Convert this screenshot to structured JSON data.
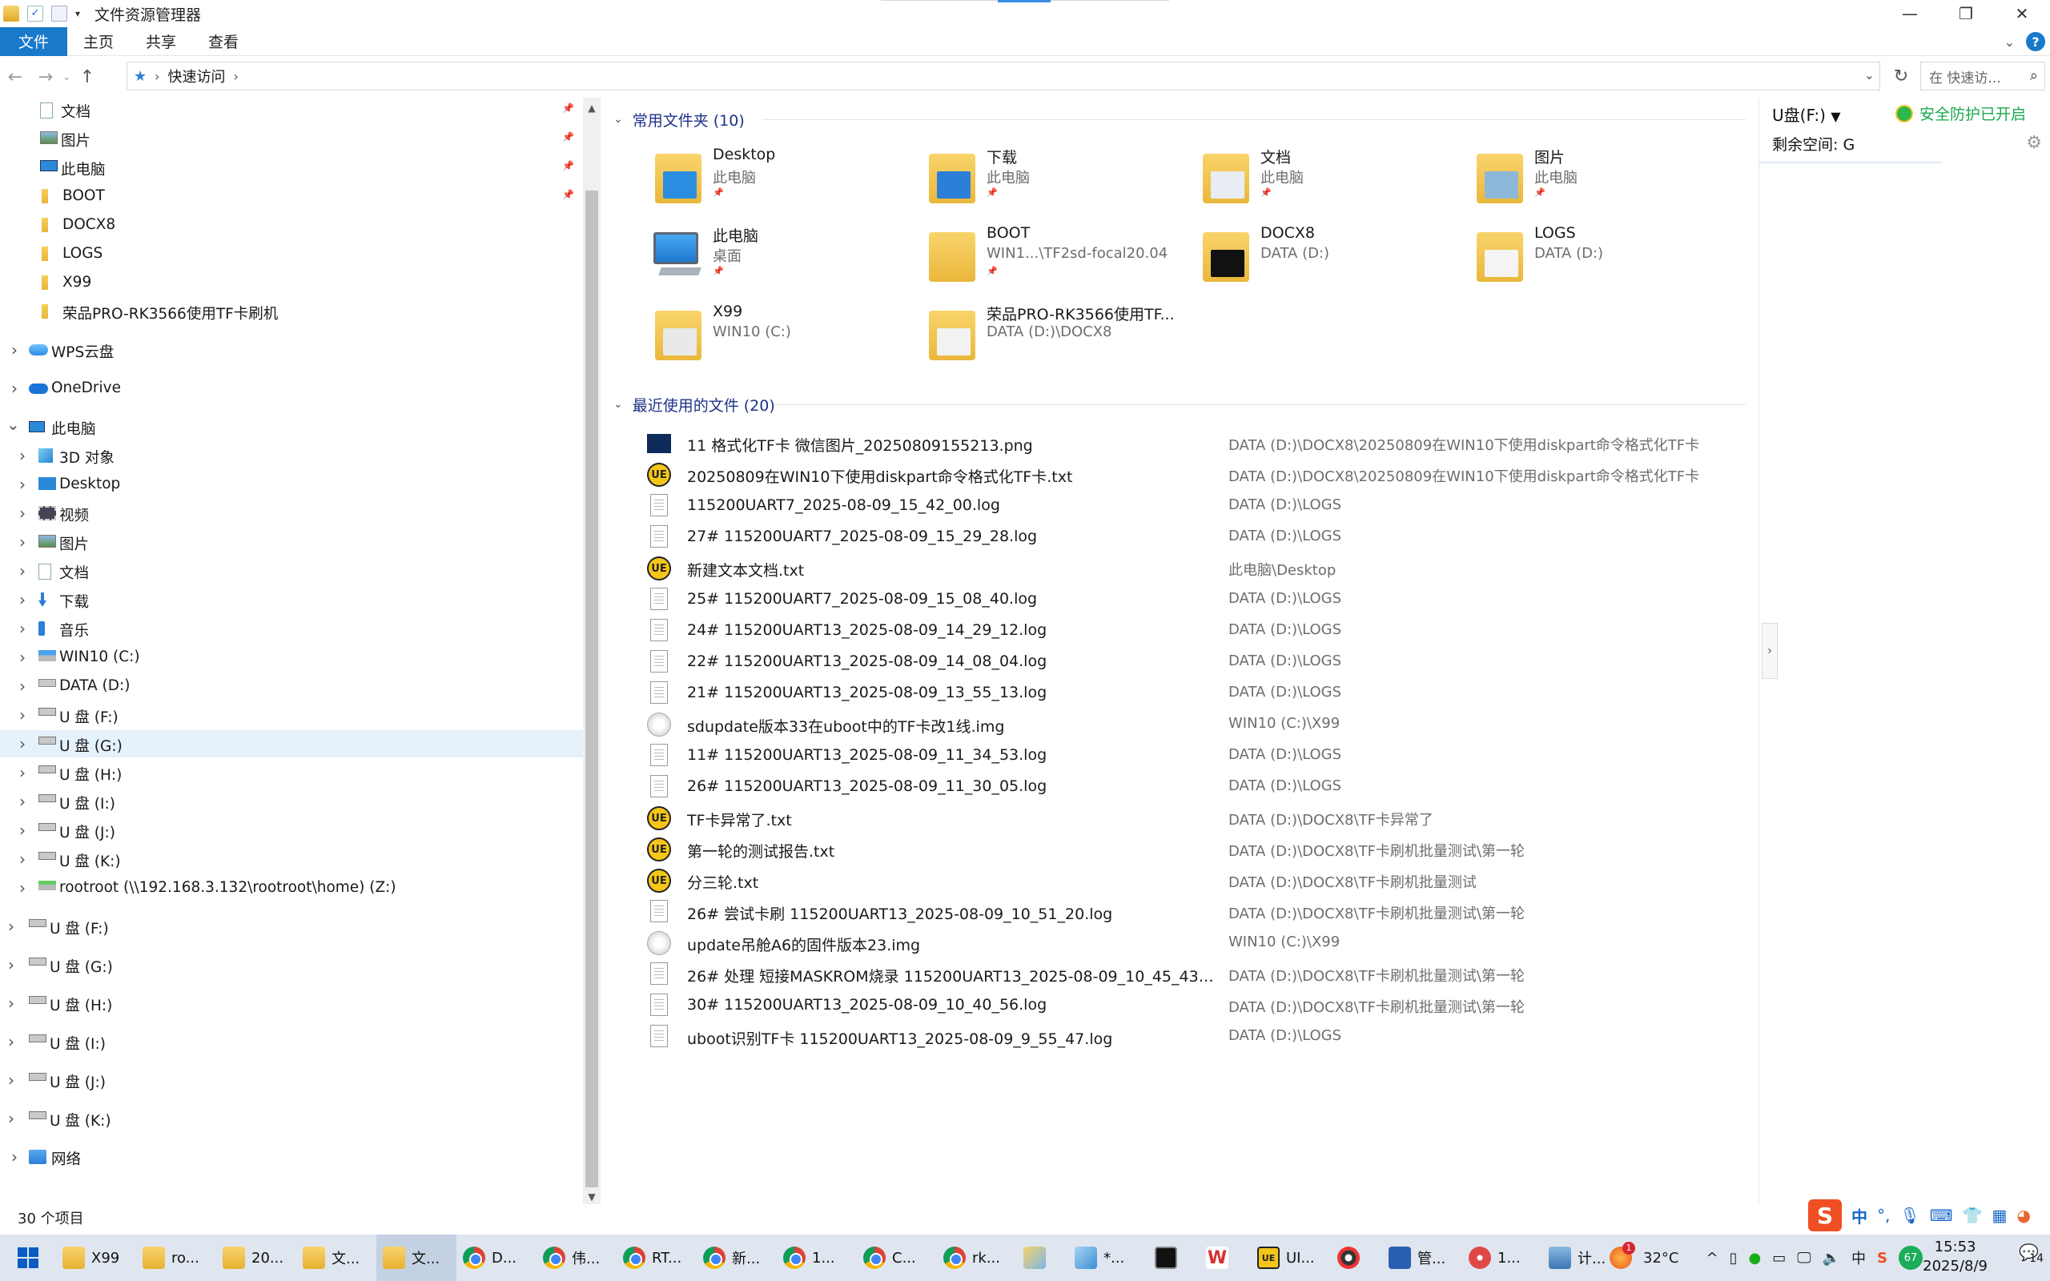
{
  "window": {
    "title": "文件资源管理器",
    "minimize_glyph": "—",
    "restore_glyph": "❐",
    "close_glyph": "✕"
  },
  "ribbon": {
    "tabs": [
      "文件",
      "主页",
      "共享",
      "查看"
    ]
  },
  "address": {
    "path": [
      "快速访问"
    ],
    "search_placeholder": "在 快速访..."
  },
  "nav": {
    "quick_access": [
      {
        "label": "文档",
        "icon": "documents-icon",
        "pinned": true
      },
      {
        "label": "图片",
        "icon": "pictures-icon",
        "pinned": true
      },
      {
        "label": "此电脑",
        "icon": "computer-icon",
        "pinned": true
      },
      {
        "label": "BOOT",
        "icon": "folder-icon",
        "pinned": true
      },
      {
        "label": "DOCX8",
        "icon": "folder-icon",
        "pinned": false
      },
      {
        "label": "LOGS",
        "icon": "folder-icon",
        "pinned": false
      },
      {
        "label": "X99",
        "icon": "folder-icon",
        "pinned": false
      },
      {
        "label": "荣品PRO-RK3566使用TF卡刷机",
        "icon": "folder-icon",
        "pinned": false
      }
    ],
    "wps": "WPS云盘",
    "onedrive": "OneDrive",
    "thispc": "此电脑",
    "thispc_children": [
      {
        "label": "3D 对象",
        "icon": "3d-objects-icon"
      },
      {
        "label": "Desktop",
        "icon": "desktop-icon"
      },
      {
        "label": "视频",
        "icon": "videos-icon"
      },
      {
        "label": "图片",
        "icon": "pictures-icon"
      },
      {
        "label": "文档",
        "icon": "documents-icon"
      },
      {
        "label": "下载",
        "icon": "downloads-icon"
      },
      {
        "label": "音乐",
        "icon": "music-icon"
      },
      {
        "label": "WIN10 (C:)",
        "icon": "system-drive-icon"
      },
      {
        "label": "DATA (D:)",
        "icon": "drive-icon"
      },
      {
        "label": "U 盘 (F:)",
        "icon": "usb-drive-icon"
      },
      {
        "label": "U 盘 (G:)",
        "icon": "usb-drive-icon",
        "selected": true
      },
      {
        "label": "U 盘 (H:)",
        "icon": "usb-drive-icon"
      },
      {
        "label": "U 盘 (I:)",
        "icon": "usb-drive-icon"
      },
      {
        "label": "U 盘 (J:)",
        "icon": "usb-drive-icon"
      },
      {
        "label": "U 盘 (K:)",
        "icon": "usb-drive-icon"
      },
      {
        "label": "rootroot (\\\\192.168.3.132\\rootroot\\home) (Z:)",
        "icon": "network-drive-icon"
      }
    ],
    "drives": [
      "U 盘 (F:)",
      "U 盘 (G:)",
      "U 盘 (H:)",
      "U 盘 (I:)",
      "U 盘 (J:)",
      "U 盘 (K:)"
    ],
    "network": "网络"
  },
  "frequent": {
    "header": "常用文件夹 (10)",
    "items": [
      {
        "name": "Desktop",
        "sub": "此电脑",
        "pinned": true,
        "overlay": "#2b8de0"
      },
      {
        "name": "下载",
        "sub": "此电脑",
        "pinned": true,
        "overlay": "#2b7fd6"
      },
      {
        "name": "文档",
        "sub": "此电脑",
        "pinned": true,
        "overlay": "#e8edf3"
      },
      {
        "name": "图片",
        "sub": "此电脑",
        "pinned": true,
        "overlay": "#8db7d8"
      },
      {
        "name": "此电脑",
        "sub": "桌面",
        "pinned": true,
        "overlay": "computer"
      },
      {
        "name": "BOOT",
        "sub": "WIN1...\\TF2sd-focal20.04",
        "pinned": true,
        "overlay": ""
      },
      {
        "name": "DOCX8",
        "sub": "DATA (D:)",
        "pinned": false,
        "overlay": "#111111"
      },
      {
        "name": "LOGS",
        "sub": "DATA (D:)",
        "pinned": false,
        "overlay": "#f4f4f4"
      },
      {
        "name": "X99",
        "sub": "WIN10 (C:)",
        "pinned": false,
        "overlay": "#e9e9e9"
      },
      {
        "name": "荣品PRO-RK3566使用TF...",
        "sub": "DATA (D:)\\DOCX8",
        "pinned": false,
        "overlay": "#f2f2f2"
      }
    ]
  },
  "recent": {
    "header": "最近使用的文件 (20)",
    "items": [
      {
        "name": "11 格式化TF卡 微信图片_20250809155213.png",
        "path": "DATA (D:)\\DOCX8\\20250809在WIN10下使用diskpart命令格式化TF卡",
        "type": "png"
      },
      {
        "name": "20250809在WIN10下使用diskpart命令格式化TF卡.txt",
        "path": "DATA (D:)\\DOCX8\\20250809在WIN10下使用diskpart命令格式化TF卡",
        "type": "ue"
      },
      {
        "name": "115200UART7_2025-08-09_15_42_00.log",
        "path": "DATA (D:)\\LOGS",
        "type": "doc"
      },
      {
        "name": "27# 115200UART7_2025-08-09_15_29_28.log",
        "path": "DATA (D:)\\LOGS",
        "type": "doc"
      },
      {
        "name": "新建文本文档.txt",
        "path": "此电脑\\Desktop",
        "type": "ue"
      },
      {
        "name": "25# 115200UART7_2025-08-09_15_08_40.log",
        "path": "DATA (D:)\\LOGS",
        "type": "doc"
      },
      {
        "name": "24# 115200UART13_2025-08-09_14_29_12.log",
        "path": "DATA (D:)\\LOGS",
        "type": "doc"
      },
      {
        "name": "22# 115200UART13_2025-08-09_14_08_04.log",
        "path": "DATA (D:)\\LOGS",
        "type": "doc"
      },
      {
        "name": "21# 115200UART13_2025-08-09_13_55_13.log",
        "path": "DATA (D:)\\LOGS",
        "type": "doc"
      },
      {
        "name": "sdupdate版本33在uboot中的TF卡改1线.img",
        "path": "WIN10 (C:)\\X99",
        "type": "img"
      },
      {
        "name": "11# 115200UART13_2025-08-09_11_34_53.log",
        "path": "DATA (D:)\\LOGS",
        "type": "doc"
      },
      {
        "name": "26# 115200UART13_2025-08-09_11_30_05.log",
        "path": "DATA (D:)\\LOGS",
        "type": "doc"
      },
      {
        "name": "TF卡异常了.txt",
        "path": "DATA (D:)\\DOCX8\\TF卡异常了",
        "type": "ue"
      },
      {
        "name": "第一轮的测试报告.txt",
        "path": "DATA (D:)\\DOCX8\\TF卡刷机批量测试\\第一轮",
        "type": "ue"
      },
      {
        "name": "分三轮.txt",
        "path": "DATA (D:)\\DOCX8\\TF卡刷机批量测试",
        "type": "ue"
      },
      {
        "name": "26# 尝试卡刷 115200UART13_2025-08-09_10_51_20.log",
        "path": "DATA (D:)\\DOCX8\\TF卡刷机批量测试\\第一轮",
        "type": "doc"
      },
      {
        "name": "update吊舱A6的固件版本23.img",
        "path": "WIN10 (C:)\\X99",
        "type": "img"
      },
      {
        "name": "26# 处理 短接MASKROM烧录 115200UART13_2025-08-09_10_45_43.log",
        "path": "DATA (D:)\\DOCX8\\TF卡刷机批量测试\\第一轮",
        "type": "doc"
      },
      {
        "name": "30# 115200UART13_2025-08-09_10_40_56.log",
        "path": "DATA (D:)\\DOCX8\\TF卡刷机批量测试\\第一轮",
        "type": "doc"
      },
      {
        "name": "uboot识别TF卡 115200UART13_2025-08-09_9_55_47.log",
        "path": "DATA (D:)\\LOGS",
        "type": "doc"
      }
    ]
  },
  "details": {
    "drive": "U盘(F:)",
    "security": "安全防护已开启",
    "free_space": "剩余空间: G"
  },
  "status": {
    "count": "30 个项目"
  },
  "ime": {
    "mode": "中",
    "punct": "°,"
  },
  "taskbar": {
    "items": [
      {
        "label": "X99",
        "icon": "folder"
      },
      {
        "label": "ro...",
        "icon": "folder"
      },
      {
        "label": "20...",
        "icon": "folder"
      },
      {
        "label": "文...",
        "icon": "explorer"
      },
      {
        "label": "文...",
        "icon": "explorer",
        "active": true
      },
      {
        "label": "D...",
        "icon": "chrome"
      },
      {
        "label": "伟...",
        "icon": "chrome"
      },
      {
        "label": "RT...",
        "icon": "chrome"
      },
      {
        "label": "新...",
        "icon": "chrome"
      },
      {
        "label": "1...",
        "icon": "chrome"
      },
      {
        "label": "C...",
        "icon": "chrome"
      },
      {
        "label": "rk...",
        "icon": "chrome"
      },
      {
        "label": "",
        "icon": "paint"
      },
      {
        "label": "*...",
        "icon": "notepad"
      },
      {
        "label": "",
        "icon": "terminal"
      },
      {
        "label": "",
        "icon": "wps"
      },
      {
        "label": "UI...",
        "icon": "ue"
      },
      {
        "label": "",
        "icon": "tool"
      },
      {
        "label": "管...",
        "icon": "powershell"
      },
      {
        "label": "1...",
        "icon": "snail"
      },
      {
        "label": "计...",
        "icon": "computer"
      }
    ],
    "weather": "32°C",
    "weather_badge": "1",
    "time": "15:53",
    "date": "2025/8/9",
    "notif_count": "14",
    "battery": "67"
  }
}
